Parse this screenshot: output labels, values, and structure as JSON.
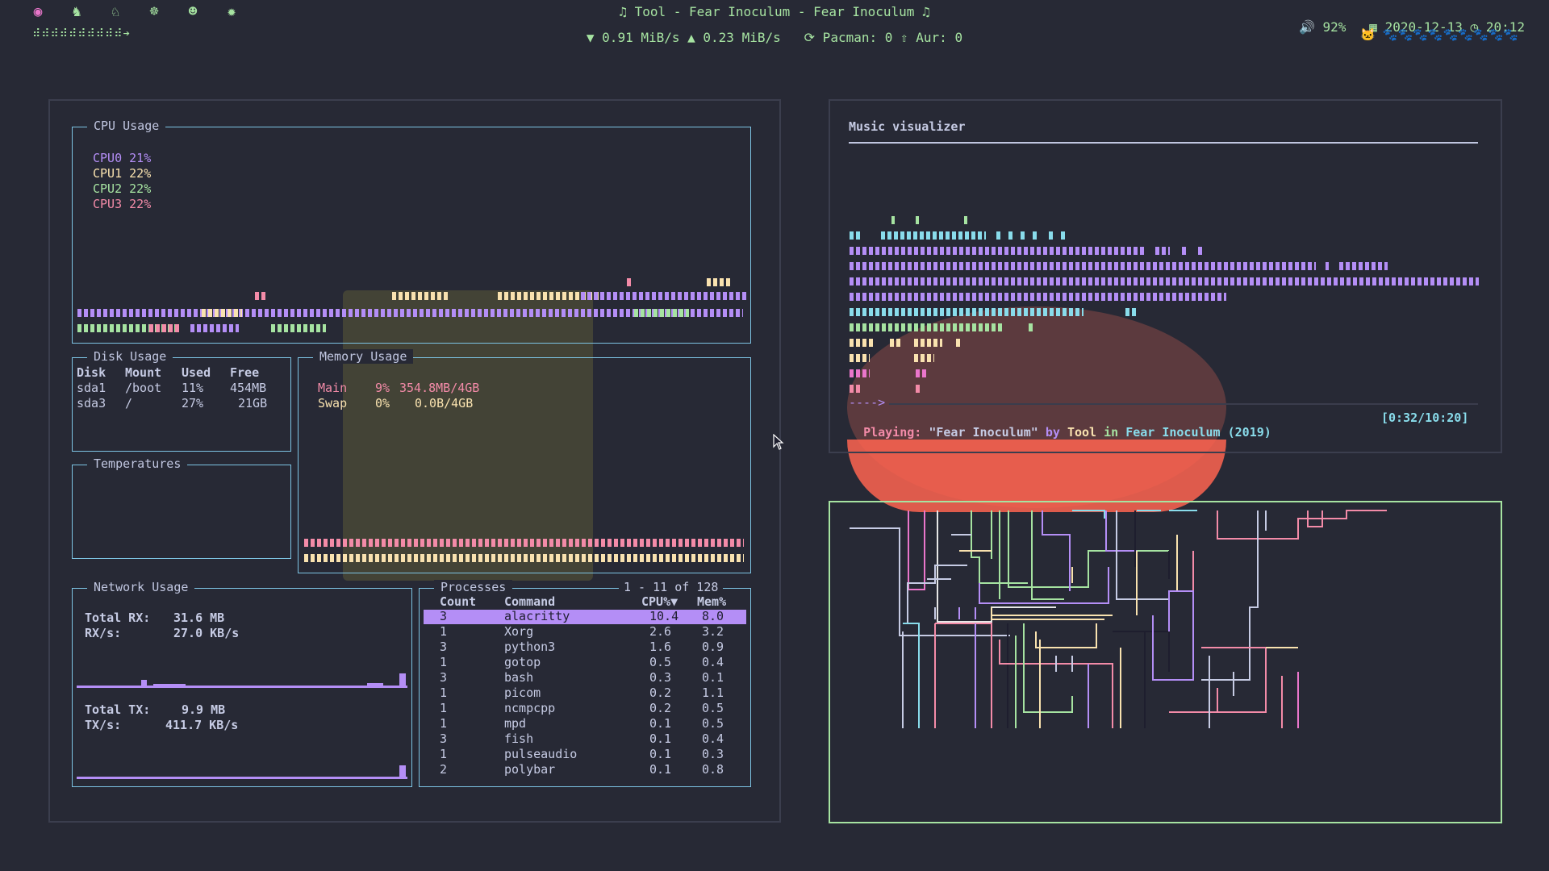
{
  "topbar": {
    "workspace_icons": [
      "brain-icon",
      "duck-icon",
      "horse-icon",
      "octopus-icon",
      "cat-icon",
      "bug-icon"
    ],
    "progress_dots": "⠾⠾⠾⠾⠾⠾⠾⠾⠾⠾➔",
    "now_playing": "♫  Tool - Fear Inoculum - Fear Inoculum  ♫",
    "net": "▼ 0.91 MiB/s ▲ 0.23 MiB/s",
    "updates": "⟳ Pacman: 0  ⇧ Aur: 0",
    "volume": "🔊 92%",
    "date": "2020-12-13",
    "time": "20:12",
    "paws": "🐱 🐾🐾🐾🐾🐾🐾🐾🐾🐾"
  },
  "cpu": {
    "title": "CPU Usage",
    "cores": [
      {
        "label": "CPU0 21%",
        "color": "#b48ef6"
      },
      {
        "label": "CPU1 22%",
        "color": "#f9e2af"
      },
      {
        "label": "CPU2 22%",
        "color": "#a6e3a1"
      },
      {
        "label": "CPU3 22%",
        "color": "#f38ba8"
      }
    ]
  },
  "disk": {
    "title": "Disk Usage",
    "headers": [
      "Disk",
      "Mount",
      "Used",
      "Free"
    ],
    "rows": [
      [
        "sda1",
        "/boot",
        "11%",
        "454MB"
      ],
      [
        "sda3",
        "/",
        "27%",
        "21GB"
      ]
    ]
  },
  "memory": {
    "title": "Memory Usage",
    "main": {
      "name": "Main",
      "pct": "9%",
      "val": "354.8MB/4GB"
    },
    "swap": {
      "name": "Swap",
      "pct": "0%",
      "val": "0.0B/4GB"
    }
  },
  "temps": {
    "title": "Temperatures"
  },
  "network": {
    "title": "Network Usage",
    "total_rx_label": "Total RX:",
    "total_rx": "31.6 MB",
    "rx_s_label": "RX/s:",
    "rx_s": "27.0 KB/s",
    "total_tx_label": "Total TX:",
    "total_tx": "9.9 MB",
    "tx_s_label": "TX/s:",
    "tx_s": "411.7 KB/s"
  },
  "processes": {
    "title": "Processes",
    "range": "1 - 11 of 128",
    "headers": [
      "Count",
      "Command",
      "CPU%▼",
      "Mem%"
    ],
    "rows": [
      [
        "3",
        "alacritty",
        "10.4",
        "8.0"
      ],
      [
        "1",
        "Xorg",
        "2.6",
        "3.2"
      ],
      [
        "3",
        "python3",
        "1.6",
        "0.9"
      ],
      [
        "1",
        "gotop",
        "0.5",
        "0.4"
      ],
      [
        "3",
        "bash",
        "0.3",
        "0.1"
      ],
      [
        "1",
        "picom",
        "0.2",
        "1.1"
      ],
      [
        "1",
        "ncmpcpp",
        "0.2",
        "0.5"
      ],
      [
        "1",
        "mpd",
        "0.1",
        "0.5"
      ],
      [
        "3",
        "fish",
        "0.1",
        "0.4"
      ],
      [
        "1",
        "pulseaudio",
        "0.1",
        "0.3"
      ],
      [
        "2",
        "polybar",
        "0.1",
        "0.8"
      ]
    ]
  },
  "music": {
    "title": "Music visualizer",
    "arrow": "---->",
    "playing_label": "Playing:",
    "song": "\"Fear Inoculum\"",
    "by": "by",
    "artist": "Tool",
    "in": "in",
    "album": "Fear Inoculum (2019)",
    "time": "[0:32/10:20]"
  },
  "colors": {
    "accent_green": "#a6e3a1",
    "accent_purple": "#b48ef6",
    "bg": "#272935"
  }
}
